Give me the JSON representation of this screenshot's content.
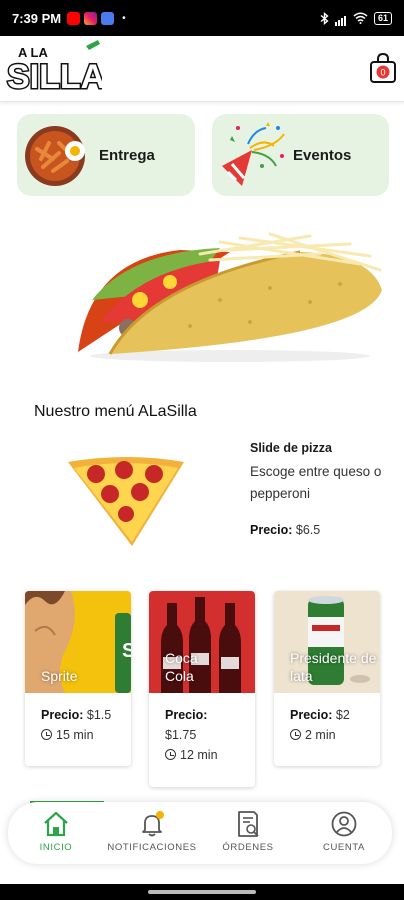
{
  "status_bar": {
    "time": "7:39 PM",
    "battery": "61",
    "dot": "•"
  },
  "header": {
    "logo_text_top": "A LA",
    "logo_text_main": "SILLA",
    "cart_count": "0",
    "brand_color": "#2fa34a"
  },
  "categories": [
    {
      "label": "Entrega",
      "icon": "food-bowl-image"
    },
    {
      "label": "Eventos",
      "icon": "party-popper-image"
    }
  ],
  "menu": {
    "title": "Nuestro menú ALaSilla",
    "featured": {
      "name": "Slide de pizza",
      "description": "Escoge entre queso o pepperoni",
      "price_label": "Precio:",
      "price": "$6.5"
    }
  },
  "products": [
    {
      "name": "Sprite",
      "price_label": "Precio:",
      "price": "$1.5",
      "time": "15 min"
    },
    {
      "name": "Coca Cola",
      "price_label": "Precio:",
      "price": "$1.75",
      "time": "12 min"
    },
    {
      "name": "Presidente de lata",
      "price_label": "Precio:",
      "price": "$2",
      "time": "2 min"
    }
  ],
  "nav": {
    "items": [
      {
        "label": "INICIO",
        "icon": "home-icon",
        "active": true
      },
      {
        "label": "NOTIFICACIONES",
        "icon": "bell-icon",
        "active": false
      },
      {
        "label": "ÓRDENES",
        "icon": "orders-icon",
        "active": false
      },
      {
        "label": "CUENTA",
        "icon": "account-icon",
        "active": false
      }
    ]
  }
}
